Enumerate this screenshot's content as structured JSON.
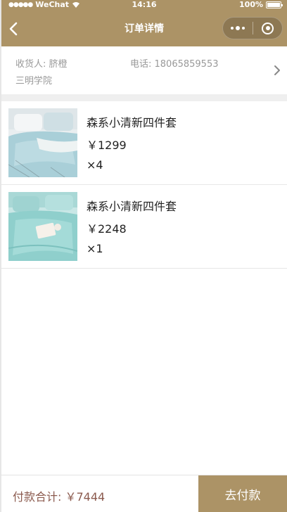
{
  "status_bar": {
    "carrier": "WeChat",
    "time": "14:16",
    "battery": "100%"
  },
  "nav": {
    "title": "订单详情"
  },
  "address": {
    "receiver": "收货人: 脐橙",
    "phone": "电话: 18065859553",
    "location": "三明学院"
  },
  "items": [
    {
      "name": "森系小清新四件套",
      "price": "￥1299",
      "quantity": "×4"
    },
    {
      "name": "森系小清新四件套",
      "price": "￥2248",
      "quantity": "×1"
    }
  ],
  "footer": {
    "total": "付款合计: ￥7444",
    "pay_button": "去付款"
  },
  "colors": {
    "brand": "#ac9366",
    "total_text": "#8b5a4e"
  },
  "icons": [
    "back-arrow-icon",
    "more-dots-icon",
    "capsule-home-icon",
    "chevron-right-icon",
    "wifi-icon",
    "battery-icon"
  ]
}
